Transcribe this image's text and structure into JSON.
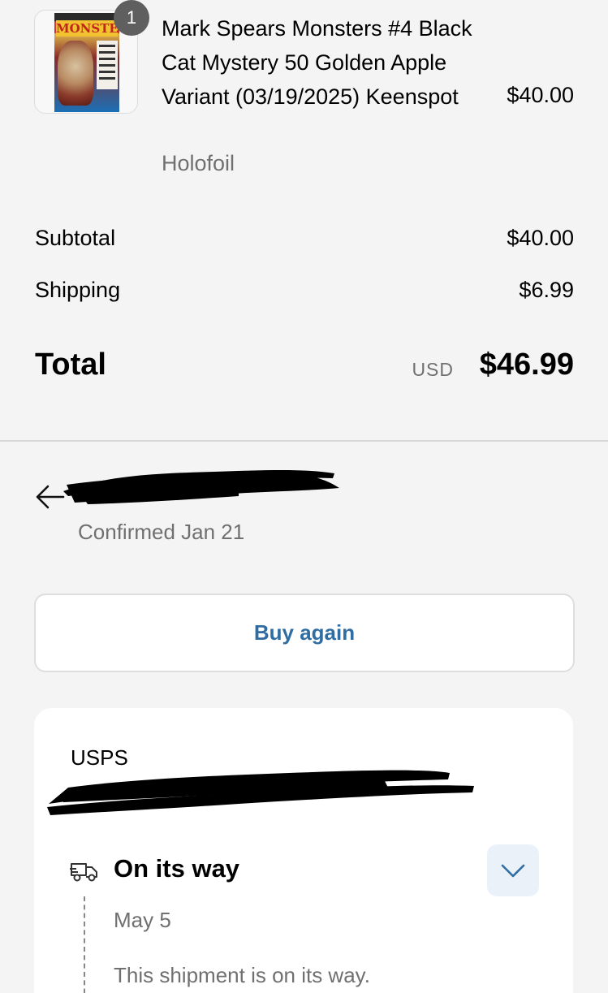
{
  "product": {
    "quantity": "1",
    "title": "Mark Spears Monsters #4 Black Cat Mystery 50 Golden Apple Variant (03/19/2025) Keenspot",
    "variant": "Holofoil",
    "price": "$40.00",
    "cover_text": "MONSTERS"
  },
  "summary": {
    "subtotal_label": "Subtotal",
    "subtotal_value": "$40.00",
    "shipping_label": "Shipping",
    "shipping_value": "$6.99",
    "total_label": "Total",
    "total_currency": "USD",
    "total_value": "$46.99"
  },
  "order": {
    "number": "",
    "confirmed": "Confirmed Jan 21"
  },
  "actions": {
    "buy_again": "Buy again"
  },
  "shipment": {
    "carrier": "USPS",
    "tracking_number": "",
    "status_title": "On its way",
    "status_date": "May 5",
    "status_description": "This shipment is on its way."
  },
  "colors": {
    "link": "#2f6da3",
    "muted_text": "#707070",
    "background": "#f4f4f4",
    "badge": "#5f5f5f",
    "expand_button_bg": "#eaf1f8"
  },
  "icons": {
    "back": "back-arrow-icon",
    "truck": "truck-icon",
    "expand": "chevron-down-icon"
  }
}
